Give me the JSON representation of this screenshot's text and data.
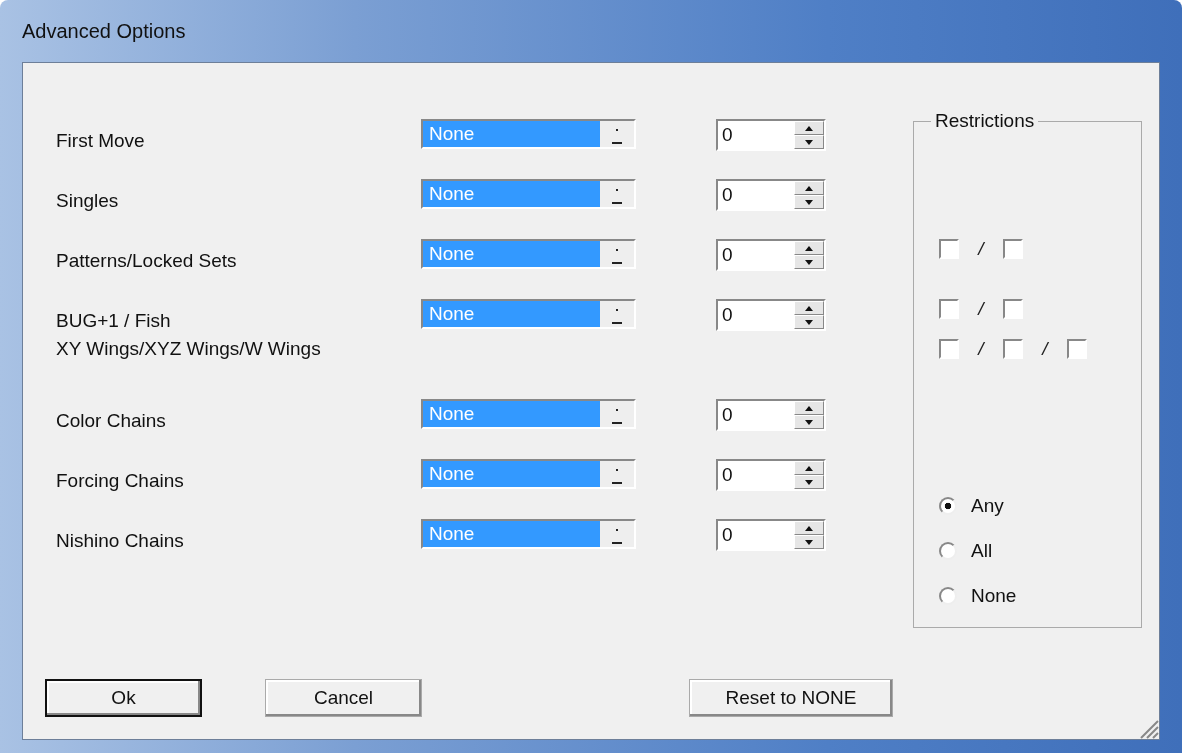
{
  "window": {
    "title": "Advanced Options"
  },
  "options": [
    {
      "label_lines": [
        "First Move"
      ],
      "choice": "None",
      "count": "0"
    },
    {
      "label_lines": [
        "Singles"
      ],
      "choice": "None",
      "count": "0"
    },
    {
      "label_lines": [
        "Patterns/Locked Sets"
      ],
      "choice": "None",
      "count": "0"
    },
    {
      "label_lines": [
        "BUG+1  / Fish",
        "XY Wings/XYZ Wings/W Wings"
      ],
      "choice": "None",
      "count": "0"
    },
    {
      "label_lines": [
        "Color Chains"
      ],
      "choice": "None",
      "count": "0"
    },
    {
      "label_lines": [
        "Forcing Chains"
      ],
      "choice": "None",
      "count": "0"
    },
    {
      "label_lines": [
        "Nishino Chains"
      ],
      "choice": "None",
      "count": "0"
    }
  ],
  "restrictions": {
    "title": "Restrictions",
    "checkbox_rows": [
      [
        {
          "kind": "checkbox",
          "checked": false
        },
        {
          "kind": "separator",
          "text": "/"
        },
        {
          "kind": "checkbox",
          "checked": false
        }
      ],
      [
        {
          "kind": "checkbox",
          "checked": false
        },
        {
          "kind": "separator",
          "text": "/"
        },
        {
          "kind": "checkbox",
          "checked": false
        }
      ],
      [
        {
          "kind": "checkbox",
          "checked": false
        },
        {
          "kind": "separator",
          "text": "/"
        },
        {
          "kind": "checkbox",
          "checked": false
        },
        {
          "kind": "separator",
          "text": "/"
        },
        {
          "kind": "checkbox",
          "checked": false
        }
      ]
    ],
    "radios": [
      {
        "label": "Any",
        "selected": true
      },
      {
        "label": "All",
        "selected": false
      },
      {
        "label": "None",
        "selected": false
      }
    ]
  },
  "buttons": [
    {
      "label": "Ok",
      "default": true
    },
    {
      "label": "Cancel",
      "default": false
    },
    {
      "label": "Reset to NONE",
      "default": false
    }
  ]
}
